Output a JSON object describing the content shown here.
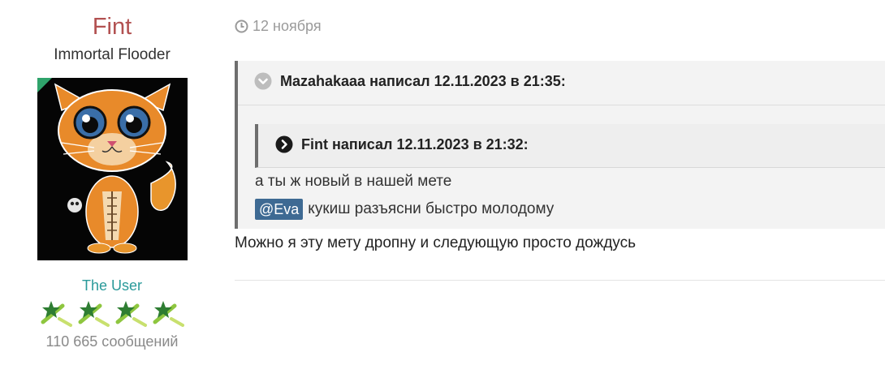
{
  "user": {
    "name": "Fint",
    "title": "Immortal Flooder",
    "group": "The User",
    "message_count": "110 665 сообщений",
    "avatar_icon": "cat-avatar",
    "online": true,
    "rank_icon": "green-star-icon",
    "rank_icon_count": 4
  },
  "post": {
    "date": "12 ноября",
    "quote_outer": {
      "header": "Mazahakaaa написал 12.11.2023 в 21:35:",
      "quote_inner": {
        "header": "Fint написал 12.11.2023 в 21:32:"
      },
      "line1": "а ты ж новый в нашей мете",
      "mention": "@Eva",
      "line2": "кукиш разъясни быстро молодому"
    },
    "text": "Можно я эту мету дропну и следующую просто дождусь"
  },
  "colors": {
    "username": "#b25151",
    "group": "#2a9a9a",
    "mention_bg": "#3e6a93",
    "quote_bg": "#f3f3f3",
    "quote_border": "#6e6e6e"
  }
}
